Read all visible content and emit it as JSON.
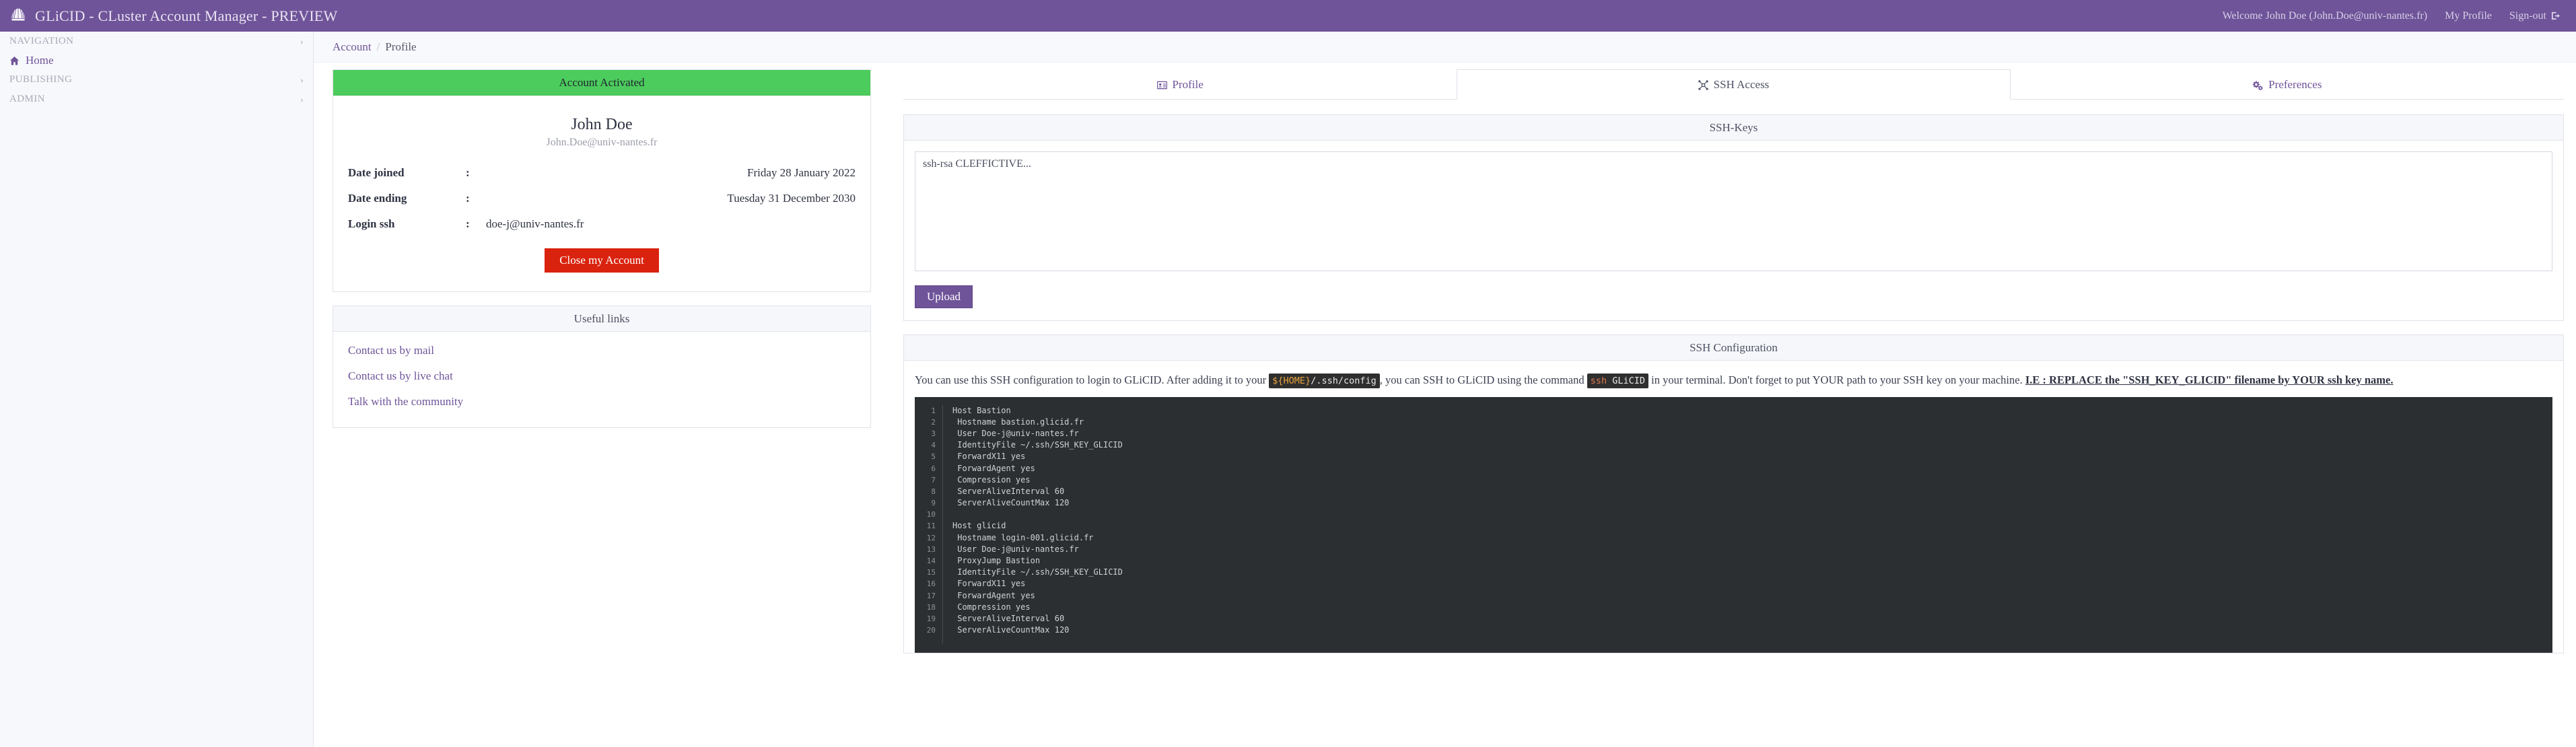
{
  "topbar": {
    "brand_title": "GLiCID - CLuster Account Manager - PREVIEW",
    "welcome": "Welcome John Doe (John.Doe@univ-nantes.fr)",
    "my_profile": "My Profile",
    "signout": "Sign-out",
    "brand_color": "#6f5499"
  },
  "sidebar": {
    "sections": [
      {
        "label": "NAVIGATION",
        "chevron": "›"
      },
      {
        "label": "PUBLISHING",
        "chevron": "›"
      },
      {
        "label": "ADMIN",
        "chevron": "›"
      }
    ],
    "home_label": "Home"
  },
  "breadcrumb": {
    "root": "Account",
    "separator": "/",
    "current": "Profile"
  },
  "account_card": {
    "status": "Account Activated",
    "status_color": "#4ccc5c",
    "name": "John Doe",
    "email": "John.Doe@univ-nantes.fr",
    "rows": [
      {
        "label": "Date joined",
        "colon": ":",
        "value": "Friday 28 January 2022",
        "align": "right"
      },
      {
        "label": "Date ending",
        "colon": ":",
        "value": "Tuesday 31 December 2030",
        "align": "right"
      },
      {
        "label": "Login ssh",
        "colon": ":",
        "value": "doe-j@univ-nantes.fr",
        "align": "left"
      }
    ],
    "close_button": "Close my Account",
    "close_button_color": "#d9230f"
  },
  "useful_links": {
    "title": "Useful links",
    "items": [
      "Contact us by mail",
      "Contact us by live chat",
      "Talk with the community"
    ]
  },
  "tabs": [
    {
      "label": "Profile",
      "icon": "id-card-icon",
      "active": false
    },
    {
      "label": "SSH Access",
      "icon": "network-share-icon",
      "active": true
    },
    {
      "label": "Preferences",
      "icon": "cogs-icon",
      "active": false
    }
  ],
  "ssh_keys": {
    "title": "SSH-Keys",
    "key_value": "ssh-rsa CLEFFICTIVE...",
    "upload_label": "Upload"
  },
  "ssh_config": {
    "title": "SSH Configuration",
    "desc_part1": "You can use this SSH configuration to login to GLiCID. After adding it to your ",
    "code_path": "${HOME}/.ssh/config",
    "code_path_var": "${HOME}",
    "code_path_rest": "/.ssh/config",
    "desc_part2": ", you can SSH to GLiCID using the command ",
    "code_cmd": "ssh GLiCID",
    "code_cmd_a": "ssh",
    "code_cmd_b": "GLiCID",
    "desc_part3": " in your terminal. Don't forget to put YOUR path to your SSH key on your machine. ",
    "desc_emph": "I.E : REPLACE the \"SSH_KEY_GLICID\" filename by YOUR ssh key name.",
    "code_lines": [
      "Host Bastion",
      " Hostname bastion.glicid.fr",
      " User Doe-j@univ-nantes.fr",
      " IdentityFile ~/.ssh/SSH_KEY_GLICID",
      " ForwardX11 yes",
      " ForwardAgent yes",
      " Compression yes",
      " ServerAliveInterval 60",
      " ServerAliveCountMax 120",
      "",
      "Host glicid",
      " Hostname login-001.glicid.fr",
      " User Doe-j@univ-nantes.fr",
      " ProxyJump Bastion",
      " IdentityFile ~/.ssh/SSH_KEY_GLICID",
      " ForwardX11 yes",
      " ForwardAgent yes",
      " Compression yes",
      " ServerAliveInterval 60",
      " ServerAliveCountMax 120"
    ]
  }
}
